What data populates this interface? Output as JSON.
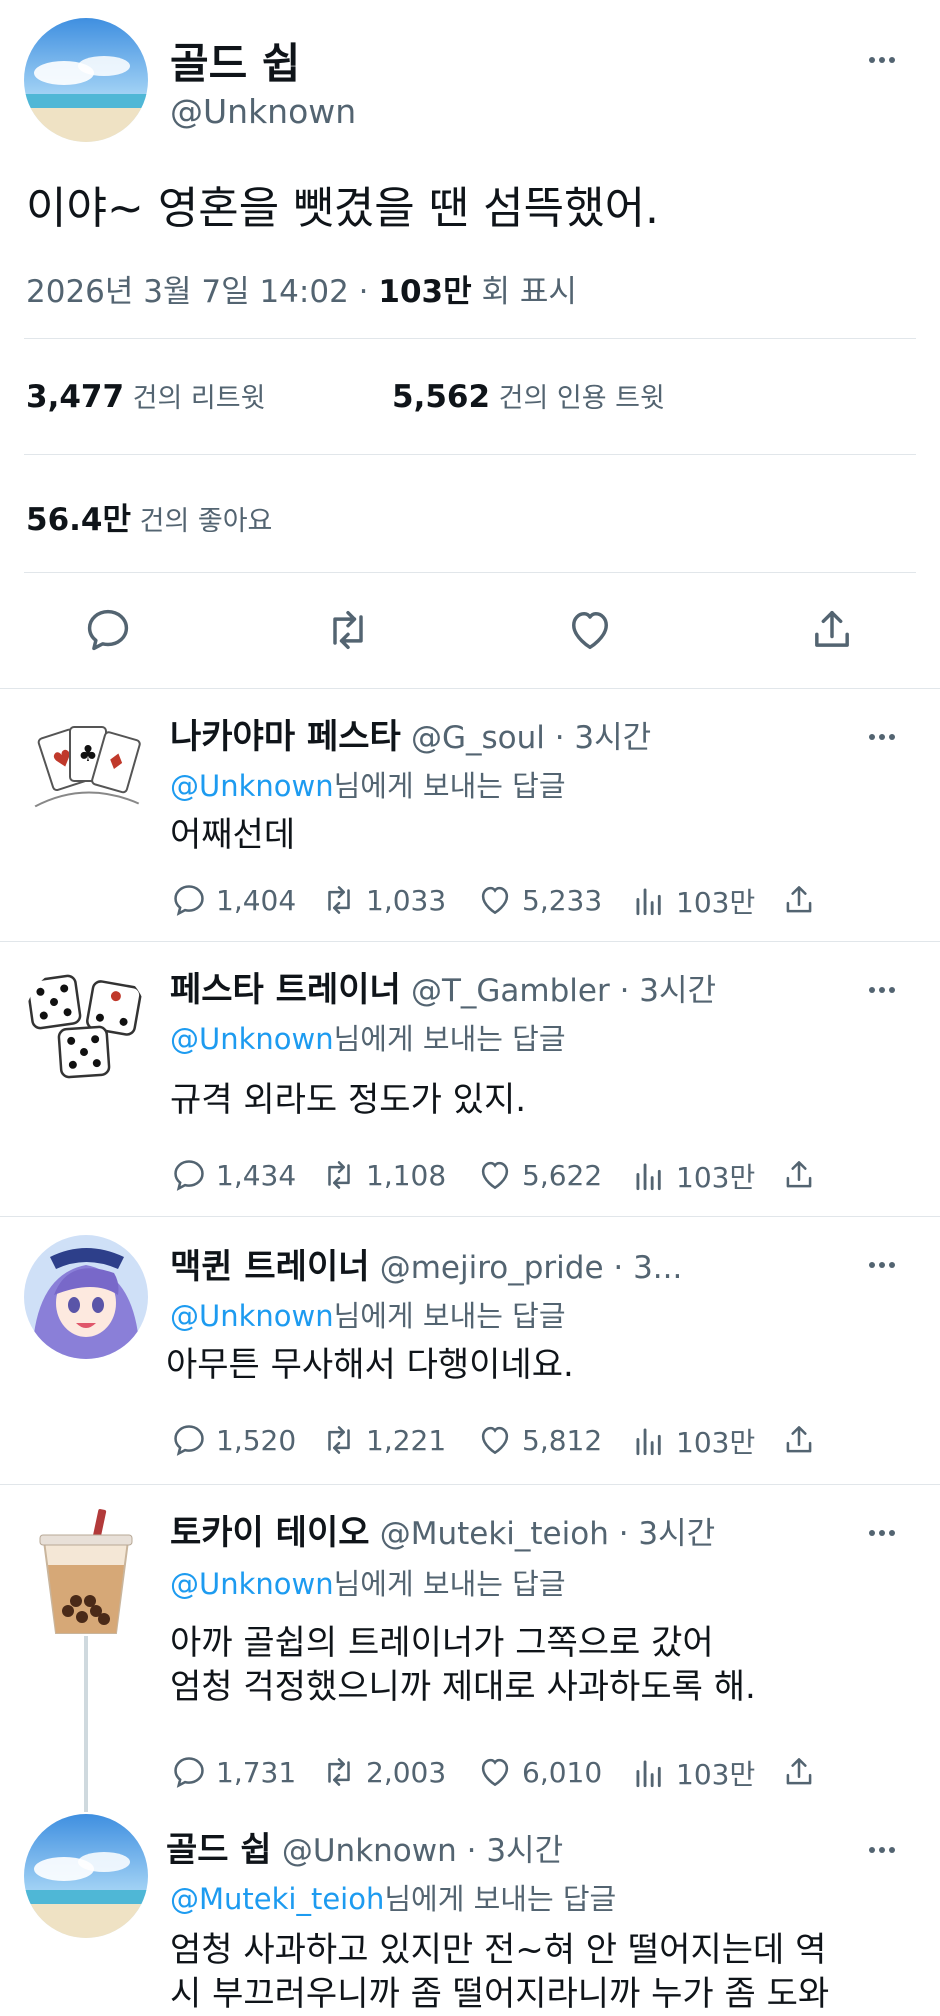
{
  "main": {
    "name": "골드 쉽",
    "handle": "@Unknown",
    "text": "이야~ 영혼을 뺏겼을 땐 섬뜩했어.",
    "date": "2026년 3월 7일  14:02 · ",
    "views_count": "103만",
    "views_label": " 회 표시",
    "retweets_count": "3,477",
    "retweets_label": " 건의 리트윗",
    "quotes_count": "5,562",
    "quotes_label": " 건의 인용 트윗",
    "likes_count": "56.4만",
    "likes_label": " 건의 좋아요"
  },
  "replies": [
    {
      "name": "나카야마 페스타",
      "handle": "@G_soul · 3시간",
      "reply_to_handle": "@Unknown",
      "reply_to_suffix": "님에게 보내는 답글",
      "text": "어째선데",
      "replies": "1,404",
      "retweets": "1,033",
      "likes": "5,233",
      "views": "103만",
      "avatar": "playing-cards"
    },
    {
      "name": "페스타 트레이너",
      "handle": "@T_Gambler · 3시간",
      "reply_to_handle": "@Unknown",
      "reply_to_suffix": "님에게 보내는 답글",
      "text": "규격 외라도 정도가 있지.",
      "replies": "1,434",
      "retweets": "1,108",
      "likes": "5,622",
      "views": "103만",
      "avatar": "dice"
    },
    {
      "name": "맥퀸 트레이너",
      "handle": "@mejiro_pride · 3...",
      "reply_to_handle": "@Unknown",
      "reply_to_suffix": "님에게 보내는 답글",
      "text": "아무튼 무사해서 다행이네요.",
      "replies": "1,520",
      "retweets": "1,221",
      "likes": "5,812",
      "views": "103만",
      "avatar": "anime-girl"
    },
    {
      "name": "토카이 테이오",
      "handle": "@Muteki_teioh · 3시간",
      "reply_to_handle": "@Unknown",
      "reply_to_suffix": "님에게 보내는 답글",
      "text_line1": "아까 골쉽의 트레이너가 그쪽으로 갔어",
      "text_line2": "엄청 걱정했으니까 제대로 사과하도록 해.",
      "replies": "1,731",
      "retweets": "2,003",
      "likes": "6,010",
      "views": "103만",
      "avatar": "bubble-tea"
    },
    {
      "name": "골드 쉽",
      "handle": "@Unknown · 3시간",
      "reply_to_handle": "@Muteki_teioh",
      "reply_to_suffix": "님에게 보내는 답글",
      "text_line1": "엄청 사과하고 있지만 전~혀 안 떨어지는데 역",
      "text_line2": "시 부끄러우니까 좀 떨어지라니까 누가 좀 도와",
      "avatar": "sky-beach"
    }
  ],
  "colors": {
    "accent": "#1d9bf0",
    "muted": "#536471",
    "text": "#0f1419",
    "divider": "#e1e6ea"
  }
}
